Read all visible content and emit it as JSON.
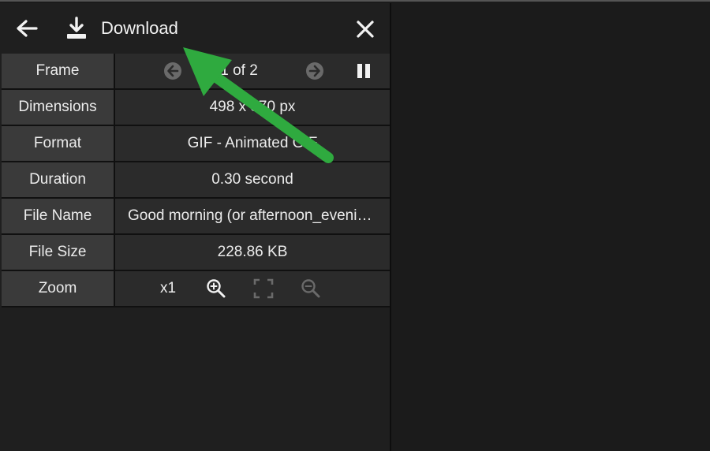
{
  "toolbar": {
    "back_icon": "arrow-left-icon",
    "download_icon": "download-icon",
    "download_label": "Download",
    "close_icon": "close-icon"
  },
  "info": {
    "rows": [
      {
        "label": "Frame"
      },
      {
        "label": "Dimensions",
        "value": "498 x 370 px"
      },
      {
        "label": "Format",
        "value": "GIF - Animated GIF"
      },
      {
        "label": "Duration",
        "value": "0.30 second"
      },
      {
        "label": "File Name",
        "value": "Good morning (or afternoon_evening) ..."
      },
      {
        "label": "File Size",
        "value": "228.86 KB"
      },
      {
        "label": "Zoom"
      }
    ],
    "frame": {
      "counter": "1 of 2",
      "prev_icon": "circle-arrow-left-icon",
      "next_icon": "circle-arrow-right-icon",
      "pause_icon": "pause-icon"
    },
    "zoom": {
      "level": "x1",
      "zoom_in_icon": "zoom-in-icon",
      "fit_icon": "fit-screen-icon",
      "zoom_out_icon": "zoom-out-icon"
    }
  },
  "colors": {
    "background": "#1b1b1b",
    "label_cell": "#3a3a3a",
    "value_cell": "#2b2b2b",
    "text": "#ececec",
    "annotation_arrow": "#2faa3f"
  }
}
